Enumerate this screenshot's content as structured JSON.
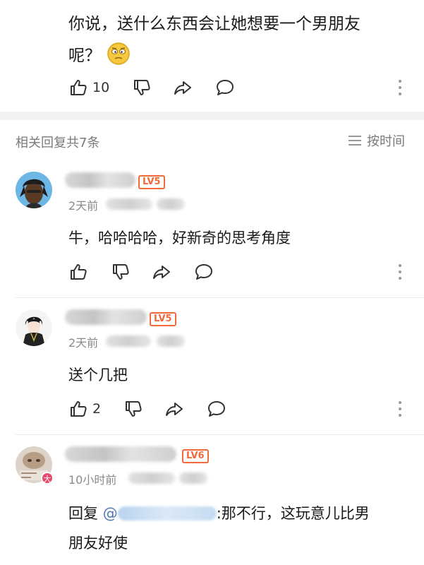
{
  "top_post": {
    "text_line1": "你说，送什么东西会让她想要一个男朋友",
    "text_line2": "呢？",
    "like_count": "10",
    "emoji": "thinking-face-emoji"
  },
  "replies": {
    "count_label": "相关回复共7条",
    "sort_label": "按时间"
  },
  "comments": [
    {
      "level": "LV5",
      "time": "2天前",
      "text": "牛，哈哈哈哈，好新奇的思考角度",
      "like_count": ""
    },
    {
      "level": "LV5",
      "time": "2天前",
      "text": "送个几把",
      "like_count": "2"
    },
    {
      "level": "LV6",
      "time": "10小时前",
      "vip_badge": "大",
      "reply_prefix": "回复",
      "mention_at": "@",
      "text_line1": ":那不行，这玩意儿比男",
      "text_line2": "朋友好使"
    }
  ],
  "colors": {
    "accent_level": "#f26a3a",
    "mention": "#4f77b5",
    "muted_text": "#7a7a7a",
    "section_gap": "#f2f2f2"
  }
}
